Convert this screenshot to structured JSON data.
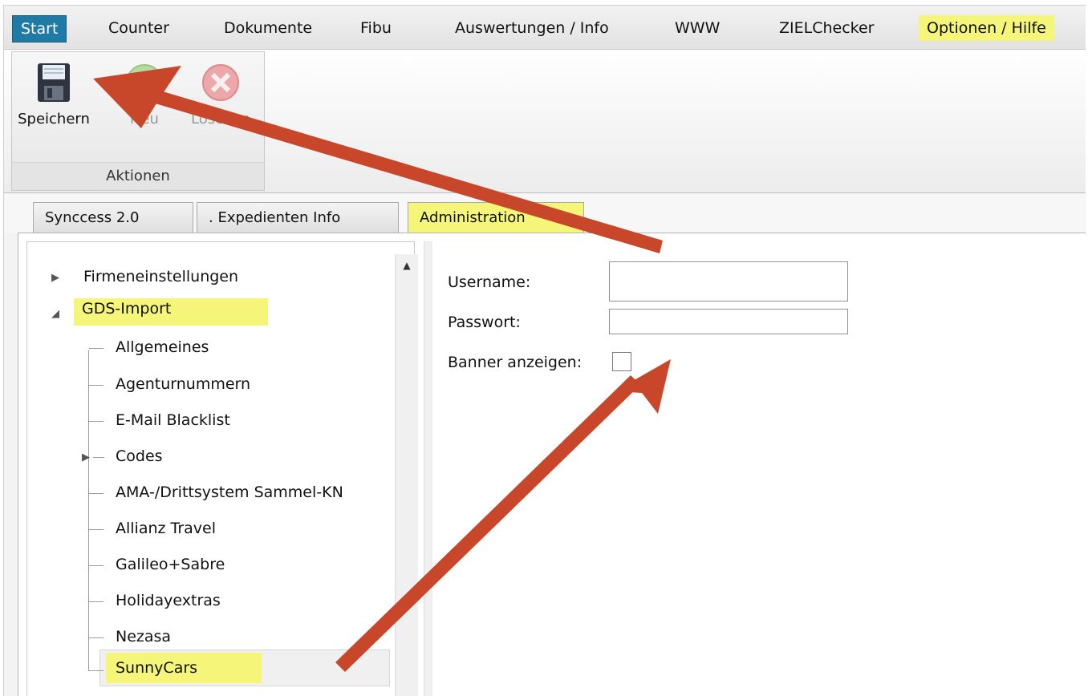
{
  "menu": {
    "items": [
      {
        "label": "Start"
      },
      {
        "label": "Counter"
      },
      {
        "label": "Dokumente"
      },
      {
        "label": "Fibu"
      },
      {
        "label": "Auswertungen / Info"
      },
      {
        "label": "WWW"
      },
      {
        "label": "ZIELChecker"
      },
      {
        "label": "Optionen / Hilfe"
      }
    ]
  },
  "ribbon": {
    "save_label": "Speichern",
    "new_label": "Neu",
    "delete_label": "Löschen",
    "group_label": "Aktionen"
  },
  "tabs": [
    {
      "label": "Synccess 2.0"
    },
    {
      "label": ". Expedienten Info"
    },
    {
      "label": "Administration"
    }
  ],
  "tree": {
    "items": [
      {
        "label": "Firmeneinstellungen"
      },
      {
        "label": "GDS-Import"
      },
      {
        "label": "Allgemeines"
      },
      {
        "label": "Agenturnummern"
      },
      {
        "label": "E-Mail Blacklist"
      },
      {
        "label": "Codes"
      },
      {
        "label": "AMA-/Drittsystem Sammel-KN"
      },
      {
        "label": "Allianz Travel"
      },
      {
        "label": "Galileo+Sabre"
      },
      {
        "label": "Holidayextras"
      },
      {
        "label": "Nezasa"
      },
      {
        "label": "SunnyCars"
      }
    ]
  },
  "form": {
    "username_label": "Username:",
    "username_value": "",
    "password_label": "Passwort:",
    "password_value": "",
    "banner_label": "Banner anzeigen:",
    "banner_checked": false
  },
  "colors": {
    "highlight": "#f5f57a",
    "active_menu": "#1f7aa6",
    "annotation_arrow": "#c8472a"
  }
}
